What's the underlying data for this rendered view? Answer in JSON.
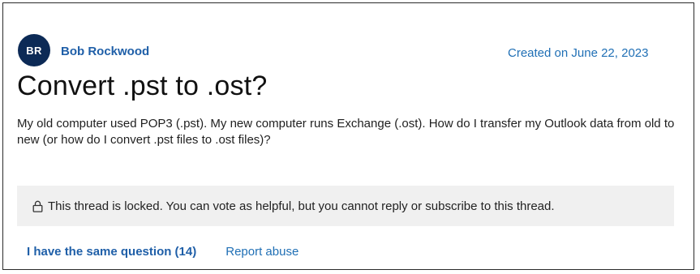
{
  "author": {
    "initials": "BR",
    "name": "Bob Rockwood",
    "avatar_color": "#0c2a56"
  },
  "created": "Created on June 22, 2023",
  "title": "Convert .pst to .ost?",
  "body": "My old computer used POP3 (.pst). My new computer runs Exchange (.ost). How do I transfer my Outlook data from old to new (or how do I convert .pst files to .ost files)?",
  "locked_notice": {
    "icon": "lock-icon",
    "text": "This thread is locked. You can vote as helpful, but you cannot reply or subscribe to this thread."
  },
  "actions": {
    "same_question": "I have the same question (14)",
    "report_abuse": "Report abuse"
  },
  "colors": {
    "link": "#1f5fa8",
    "notice_bg": "#f0f0f0"
  }
}
